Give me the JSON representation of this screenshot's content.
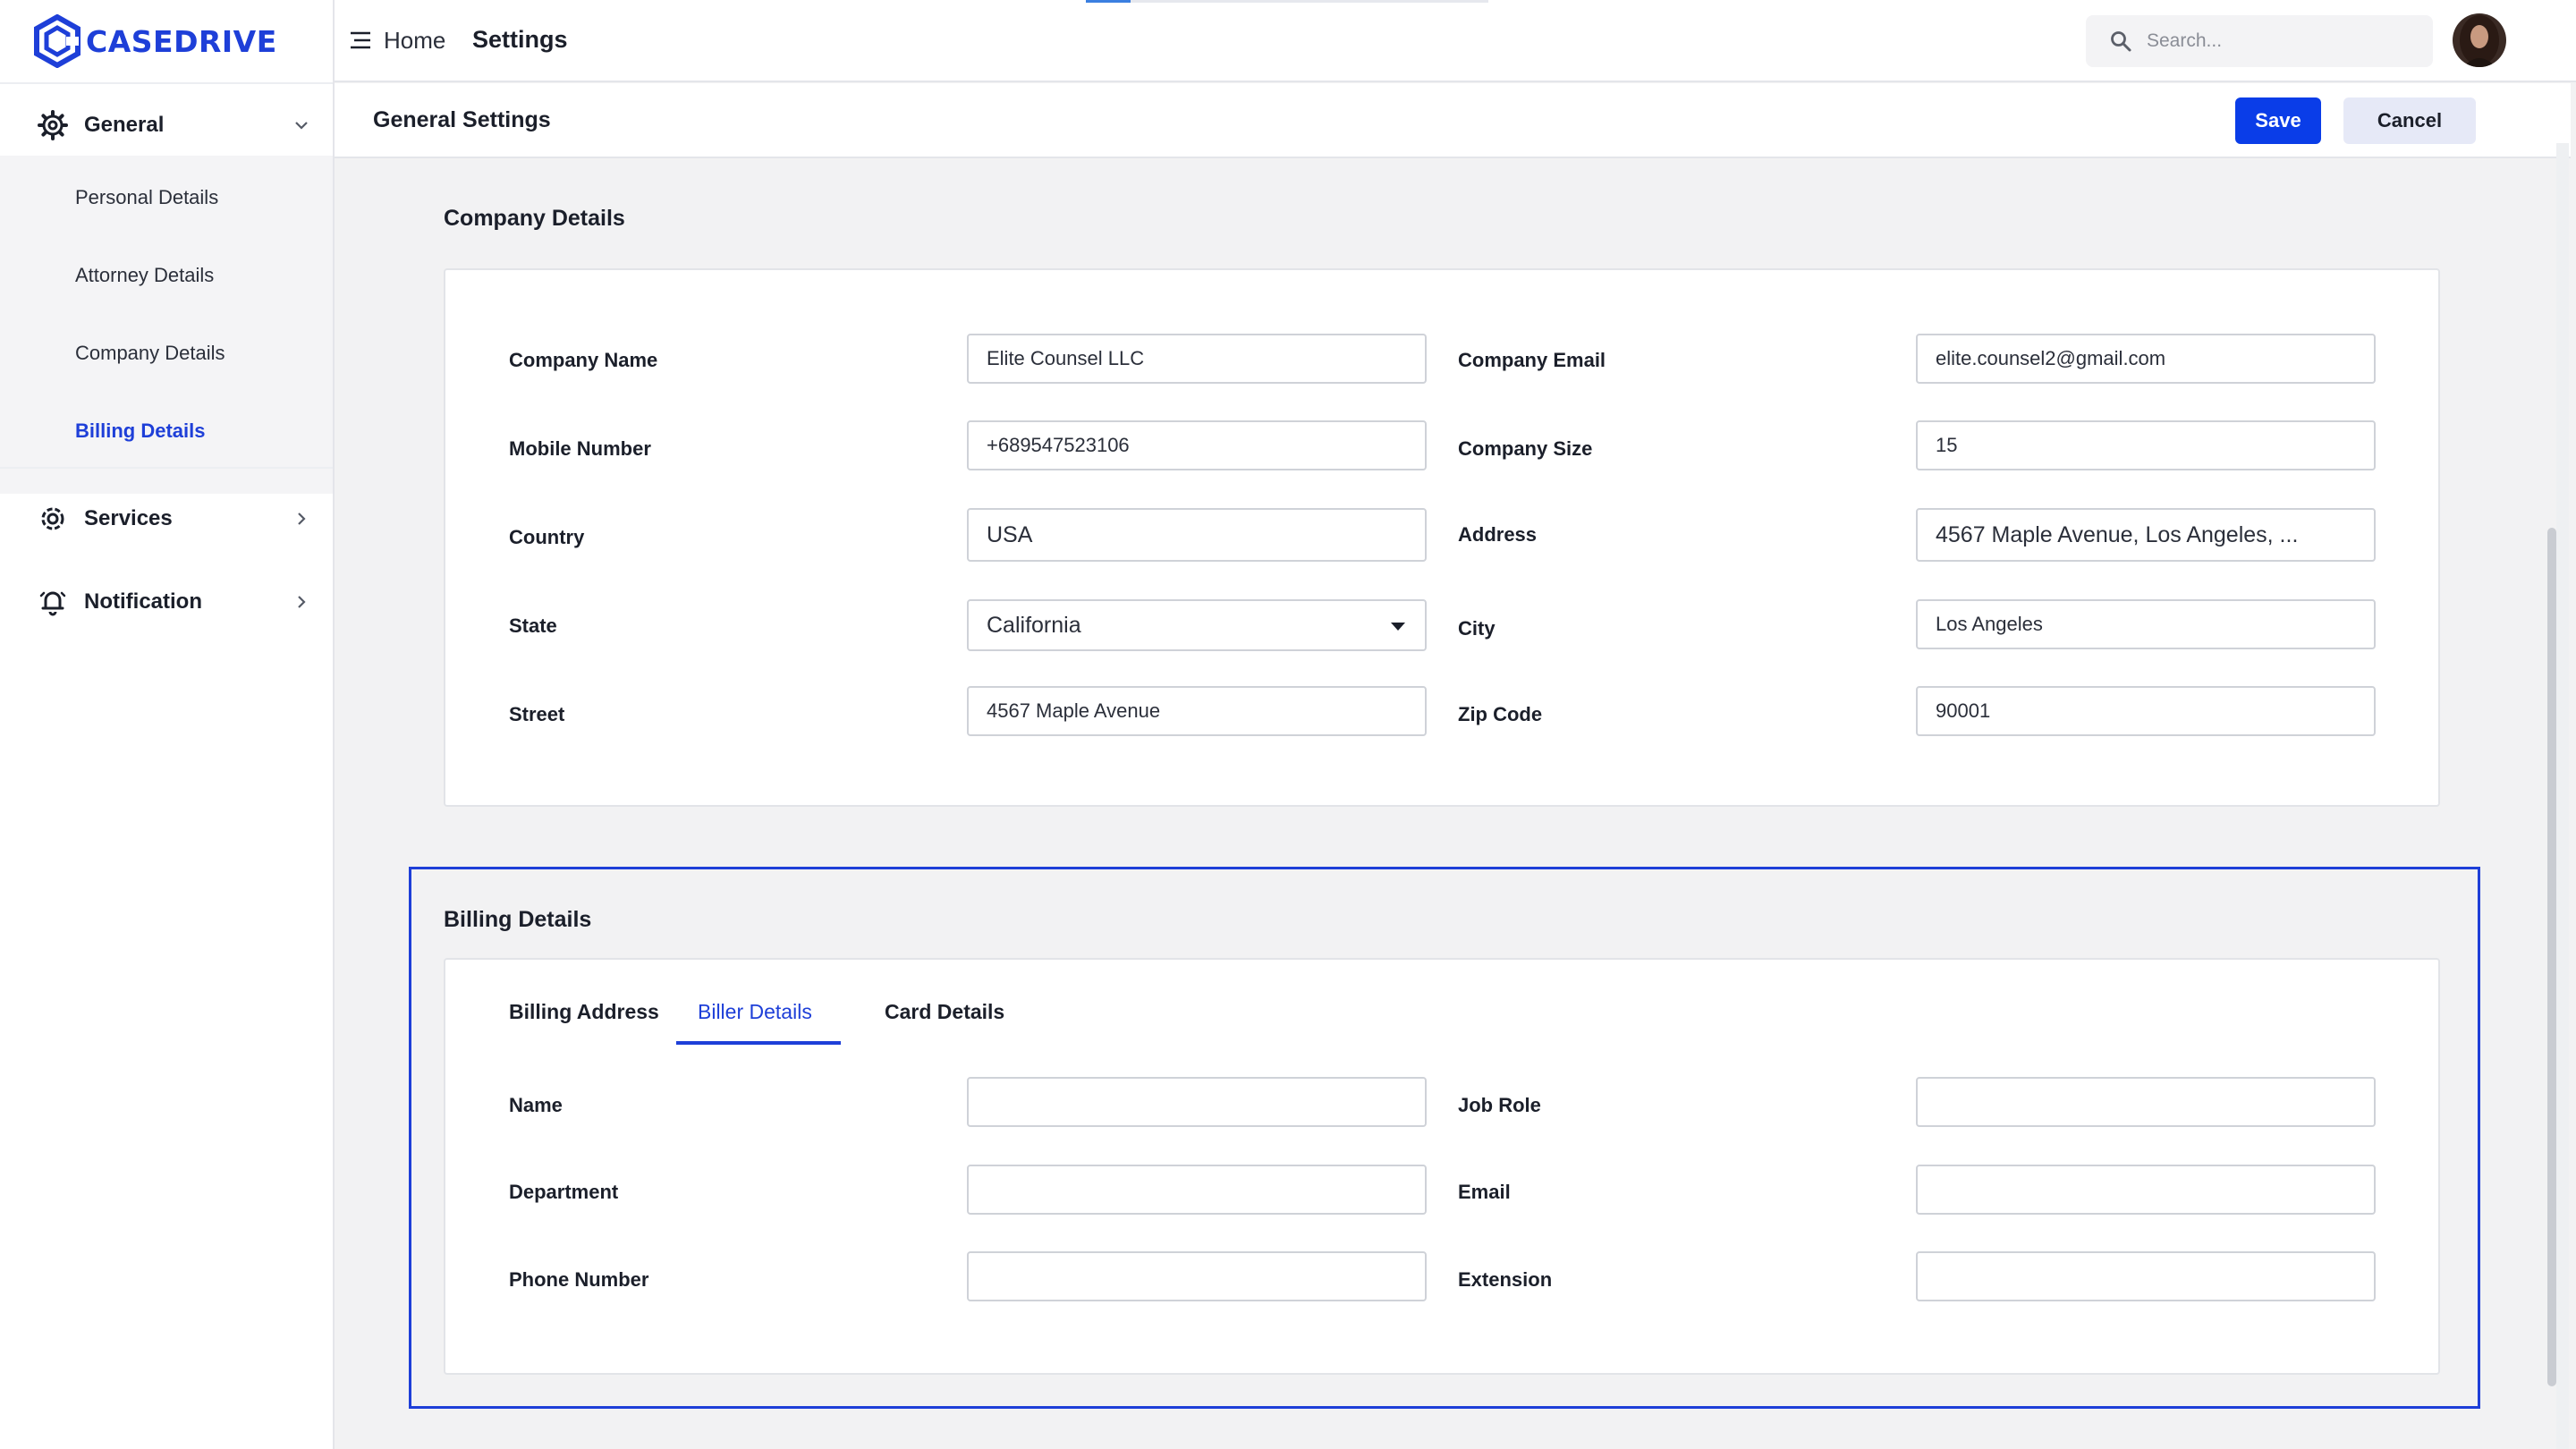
{
  "brand": {
    "name": "CASEDRIVE",
    "color": "#1e3fd8"
  },
  "topbar": {
    "breadcrumb": {
      "home": "Home",
      "current": "Settings"
    },
    "search_placeholder": "Search...",
    "progress_percent": 11
  },
  "sidebar": {
    "sections": [
      {
        "label": "General",
        "icon": "gear-icon",
        "expanded": true
      },
      {
        "label": "Services",
        "icon": "settings-cog-icon",
        "expanded": false
      },
      {
        "label": "Notification",
        "icon": "bell-icon",
        "expanded": false
      }
    ],
    "general_items": [
      "Personal Details",
      "Attorney Details",
      "Company Details",
      "Billing Details"
    ],
    "active_item": "Billing Details"
  },
  "header": {
    "title": "General Settings",
    "save_label": "Save",
    "cancel_label": "Cancel"
  },
  "company": {
    "title": "Company Details",
    "fields": {
      "company_name": {
        "label": "Company Name",
        "value": "Elite Counsel LLC"
      },
      "company_email": {
        "label": "Company Email",
        "value": "elite.counsel2@gmail.com"
      },
      "mobile_number": {
        "label": "Mobile Number",
        "value": "+689547523106"
      },
      "company_size": {
        "label": "Company Size",
        "value": "15"
      },
      "country": {
        "label": "Country",
        "value": "USA"
      },
      "address": {
        "label": "Address",
        "value": "4567 Maple Avenue, Los Angeles, ..."
      },
      "state": {
        "label": "State",
        "value": "California"
      },
      "city": {
        "label": "City",
        "value": "Los Angeles"
      },
      "street": {
        "label": "Street",
        "value": "4567 Maple Avenue"
      },
      "zip_code": {
        "label": "Zip Code",
        "value": "90001"
      }
    }
  },
  "billing": {
    "title": "Billing Details",
    "tabs": [
      "Billing Address",
      "Biller Details",
      "Card Details"
    ],
    "active_tab": "Biller Details",
    "fields": {
      "name": {
        "label": "Name",
        "value": ""
      },
      "job_role": {
        "label": "Job Role",
        "value": ""
      },
      "department": {
        "label": "Department",
        "value": ""
      },
      "email": {
        "label": "Email",
        "value": ""
      },
      "phone_number": {
        "label": "Phone Number",
        "value": ""
      },
      "extension": {
        "label": "Extension",
        "value": ""
      }
    }
  }
}
